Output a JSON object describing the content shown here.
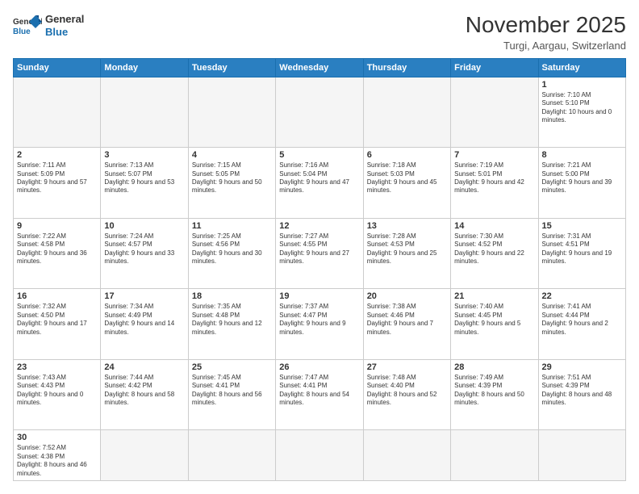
{
  "logo": {
    "line1": "General",
    "line2": "Blue"
  },
  "title": "November 2025",
  "subtitle": "Turgi, Aargau, Switzerland",
  "weekdays": [
    "Sunday",
    "Monday",
    "Tuesday",
    "Wednesday",
    "Thursday",
    "Friday",
    "Saturday"
  ],
  "weeks": [
    [
      {
        "day": "",
        "info": ""
      },
      {
        "day": "",
        "info": ""
      },
      {
        "day": "",
        "info": ""
      },
      {
        "day": "",
        "info": ""
      },
      {
        "day": "",
        "info": ""
      },
      {
        "day": "",
        "info": ""
      },
      {
        "day": "1",
        "info": "Sunrise: 7:10 AM\nSunset: 5:10 PM\nDaylight: 10 hours and 0 minutes."
      }
    ],
    [
      {
        "day": "2",
        "info": "Sunrise: 7:11 AM\nSunset: 5:09 PM\nDaylight: 9 hours and 57 minutes."
      },
      {
        "day": "3",
        "info": "Sunrise: 7:13 AM\nSunset: 5:07 PM\nDaylight: 9 hours and 53 minutes."
      },
      {
        "day": "4",
        "info": "Sunrise: 7:15 AM\nSunset: 5:05 PM\nDaylight: 9 hours and 50 minutes."
      },
      {
        "day": "5",
        "info": "Sunrise: 7:16 AM\nSunset: 5:04 PM\nDaylight: 9 hours and 47 minutes."
      },
      {
        "day": "6",
        "info": "Sunrise: 7:18 AM\nSunset: 5:03 PM\nDaylight: 9 hours and 45 minutes."
      },
      {
        "day": "7",
        "info": "Sunrise: 7:19 AM\nSunset: 5:01 PM\nDaylight: 9 hours and 42 minutes."
      },
      {
        "day": "8",
        "info": "Sunrise: 7:21 AM\nSunset: 5:00 PM\nDaylight: 9 hours and 39 minutes."
      }
    ],
    [
      {
        "day": "9",
        "info": "Sunrise: 7:22 AM\nSunset: 4:58 PM\nDaylight: 9 hours and 36 minutes."
      },
      {
        "day": "10",
        "info": "Sunrise: 7:24 AM\nSunset: 4:57 PM\nDaylight: 9 hours and 33 minutes."
      },
      {
        "day": "11",
        "info": "Sunrise: 7:25 AM\nSunset: 4:56 PM\nDaylight: 9 hours and 30 minutes."
      },
      {
        "day": "12",
        "info": "Sunrise: 7:27 AM\nSunset: 4:55 PM\nDaylight: 9 hours and 27 minutes."
      },
      {
        "day": "13",
        "info": "Sunrise: 7:28 AM\nSunset: 4:53 PM\nDaylight: 9 hours and 25 minutes."
      },
      {
        "day": "14",
        "info": "Sunrise: 7:30 AM\nSunset: 4:52 PM\nDaylight: 9 hours and 22 minutes."
      },
      {
        "day": "15",
        "info": "Sunrise: 7:31 AM\nSunset: 4:51 PM\nDaylight: 9 hours and 19 minutes."
      }
    ],
    [
      {
        "day": "16",
        "info": "Sunrise: 7:32 AM\nSunset: 4:50 PM\nDaylight: 9 hours and 17 minutes."
      },
      {
        "day": "17",
        "info": "Sunrise: 7:34 AM\nSunset: 4:49 PM\nDaylight: 9 hours and 14 minutes."
      },
      {
        "day": "18",
        "info": "Sunrise: 7:35 AM\nSunset: 4:48 PM\nDaylight: 9 hours and 12 minutes."
      },
      {
        "day": "19",
        "info": "Sunrise: 7:37 AM\nSunset: 4:47 PM\nDaylight: 9 hours and 9 minutes."
      },
      {
        "day": "20",
        "info": "Sunrise: 7:38 AM\nSunset: 4:46 PM\nDaylight: 9 hours and 7 minutes."
      },
      {
        "day": "21",
        "info": "Sunrise: 7:40 AM\nSunset: 4:45 PM\nDaylight: 9 hours and 5 minutes."
      },
      {
        "day": "22",
        "info": "Sunrise: 7:41 AM\nSunset: 4:44 PM\nDaylight: 9 hours and 2 minutes."
      }
    ],
    [
      {
        "day": "23",
        "info": "Sunrise: 7:43 AM\nSunset: 4:43 PM\nDaylight: 9 hours and 0 minutes."
      },
      {
        "day": "24",
        "info": "Sunrise: 7:44 AM\nSunset: 4:42 PM\nDaylight: 8 hours and 58 minutes."
      },
      {
        "day": "25",
        "info": "Sunrise: 7:45 AM\nSunset: 4:41 PM\nDaylight: 8 hours and 56 minutes."
      },
      {
        "day": "26",
        "info": "Sunrise: 7:47 AM\nSunset: 4:41 PM\nDaylight: 8 hours and 54 minutes."
      },
      {
        "day": "27",
        "info": "Sunrise: 7:48 AM\nSunset: 4:40 PM\nDaylight: 8 hours and 52 minutes."
      },
      {
        "day": "28",
        "info": "Sunrise: 7:49 AM\nSunset: 4:39 PM\nDaylight: 8 hours and 50 minutes."
      },
      {
        "day": "29",
        "info": "Sunrise: 7:51 AM\nSunset: 4:39 PM\nDaylight: 8 hours and 48 minutes."
      }
    ],
    [
      {
        "day": "30",
        "info": "Sunrise: 7:52 AM\nSunset: 4:38 PM\nDaylight: 8 hours and 46 minutes."
      },
      {
        "day": "",
        "info": ""
      },
      {
        "day": "",
        "info": ""
      },
      {
        "day": "",
        "info": ""
      },
      {
        "day": "",
        "info": ""
      },
      {
        "day": "",
        "info": ""
      },
      {
        "day": "",
        "info": ""
      }
    ]
  ]
}
